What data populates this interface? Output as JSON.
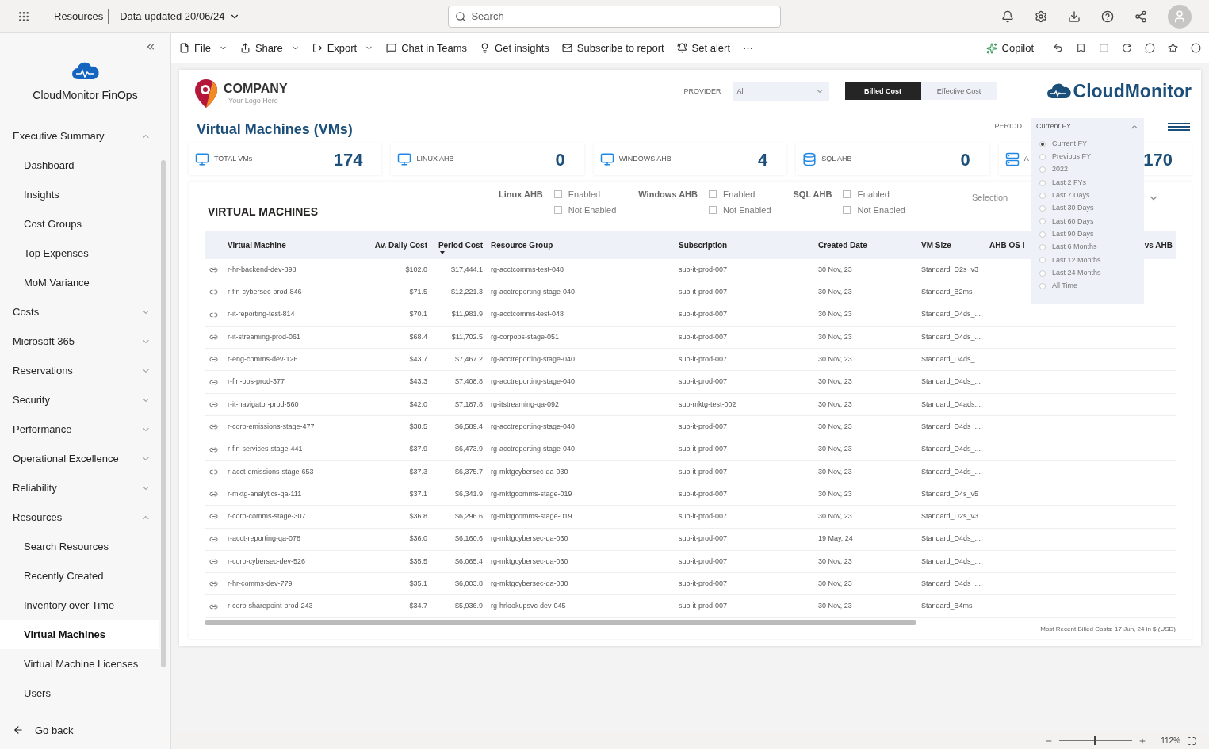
{
  "topbar": {
    "breadcrumb": "Resources",
    "data_updated": "Data updated 20/06/24",
    "search": {
      "placeholder": "Search"
    }
  },
  "sidebar": {
    "title": "CloudMonitor FinOps",
    "items": [
      {
        "label": "Executive Summary",
        "expanded": true,
        "children": [
          {
            "label": "Dashboard",
            "selected": false
          },
          {
            "label": "Insights",
            "selected": false
          },
          {
            "label": "Cost Groups",
            "selected": false
          },
          {
            "label": "Top Expenses",
            "selected": false
          },
          {
            "label": "MoM Variance",
            "selected": false
          }
        ]
      },
      {
        "label": "Costs",
        "expanded": false
      },
      {
        "label": "Microsoft 365",
        "expanded": false
      },
      {
        "label": "Reservations",
        "expanded": false
      },
      {
        "label": "Security",
        "expanded": false
      },
      {
        "label": "Performance",
        "expanded": false
      },
      {
        "label": "Operational Excellence",
        "expanded": false
      },
      {
        "label": "Reliability",
        "expanded": false
      },
      {
        "label": "Resources",
        "expanded": true,
        "children": [
          {
            "label": "Search Resources",
            "selected": false
          },
          {
            "label": "Recently Created",
            "selected": false
          },
          {
            "label": "Inventory over Time",
            "selected": false
          },
          {
            "label": "Virtual Machines",
            "selected": true
          },
          {
            "label": "Virtual Machine Licenses",
            "selected": false
          },
          {
            "label": "Users",
            "selected": false
          }
        ]
      }
    ],
    "go_back": "Go back"
  },
  "toolbar": {
    "left": [
      {
        "label": "File",
        "kind": "file",
        "caret": true
      },
      {
        "label": "Share",
        "kind": "share",
        "caret": true
      },
      {
        "label": "Export",
        "kind": "export",
        "caret": true
      },
      {
        "label": "Chat in Teams",
        "kind": "teams",
        "caret": false
      },
      {
        "label": "Get insights",
        "kind": "insights",
        "caret": false
      },
      {
        "label": "Subscribe to report",
        "kind": "subscribe",
        "caret": false
      },
      {
        "label": "Set alert",
        "kind": "alert",
        "caret": false
      }
    ],
    "more": "⋯",
    "copilot": "Copilot"
  },
  "report": {
    "logo": {
      "name": "COMPANY",
      "tagline": "Your Logo Here"
    },
    "title": "Virtual Machines (VMs)",
    "brand": "CloudMonitor",
    "provider": {
      "label": "PROVIDER",
      "value": "All"
    },
    "cost_toggle": [
      {
        "label": "Billed Cost",
        "selected": true
      },
      {
        "label": "Effective Cost",
        "selected": false
      }
    ],
    "period": {
      "label": "PERIOD",
      "value": "Current FY",
      "options": [
        {
          "label": "Current FY",
          "selected": true
        },
        {
          "label": "Previous FY",
          "selected": false
        },
        {
          "label": "2022",
          "selected": false
        },
        {
          "label": "Last 2 FYs",
          "selected": false
        },
        {
          "label": "Last 7 Days",
          "selected": false
        },
        {
          "label": "Last 30 Days",
          "selected": false
        },
        {
          "label": "Last 60 Days",
          "selected": false
        },
        {
          "label": "Last 90 Days",
          "selected": false
        },
        {
          "label": "Last 6 Months",
          "selected": false
        },
        {
          "label": "Last 12 Months",
          "selected": false
        },
        {
          "label": "Last 24 Months",
          "selected": false
        },
        {
          "label": "All Time",
          "selected": false
        }
      ]
    },
    "kpis": [
      {
        "label": "TOTAL VMs",
        "value": "174",
        "kind": "vm"
      },
      {
        "label": "LINUX AHB",
        "value": "0",
        "kind": "vm"
      },
      {
        "label": "WINDOWS AHB",
        "value": "4",
        "kind": "vm"
      },
      {
        "label": "SQL AHB",
        "value": "0",
        "kind": "sql"
      },
      {
        "label": "A",
        "value": "170",
        "kind": "server"
      }
    ],
    "section_title": "VIRTUAL MACHINES",
    "filters": [
      {
        "label": "Linux AHB",
        "options": [
          {
            "label": "Enabled",
            "checked": false
          },
          {
            "label": "Not Enabled",
            "checked": false
          }
        ]
      },
      {
        "label": "Windows AHB",
        "options": [
          {
            "label": "Enabled",
            "checked": false
          },
          {
            "label": "Not Enabled",
            "checked": false
          }
        ]
      },
      {
        "label": "SQL AHB",
        "options": [
          {
            "label": "Enabled",
            "checked": false
          },
          {
            "label": "Not Enabled",
            "checked": false
          }
        ]
      }
    ],
    "selection": {
      "placeholder": "Selection"
    },
    "table": {
      "columns": [
        {
          "label": "Virtual Machine",
          "sorted": false
        },
        {
          "label": "Av. Daily Cost",
          "sorted": false
        },
        {
          "label": "Period Cost",
          "sorted": true
        },
        {
          "label": "Resource Group",
          "sorted": false
        },
        {
          "label": "Subscription",
          "sorted": false
        },
        {
          "label": "Created Date",
          "sorted": false
        },
        {
          "label": "VM Size",
          "sorted": false
        },
        {
          "label": "AHB OS I",
          "sorted": false
        },
        {
          "label": "vs AHB",
          "sorted": false
        }
      ],
      "rows": [
        [
          "r-hr-backend-dev-898",
          "$102.0",
          "$17,444.1",
          "rg-acctcomms-test-048",
          "sub-it-prod-007",
          "30 Nov, 23",
          "Standard_D2s_v3"
        ],
        [
          "r-fin-cybersec-prod-846",
          "$71.5",
          "$12,221.3",
          "rg-acctreporting-stage-040",
          "sub-it-prod-007",
          "30 Nov, 23",
          "Standard_B2ms"
        ],
        [
          "r-it-reporting-test-814",
          "$70.1",
          "$11,981.9",
          "rg-acctcomms-test-048",
          "sub-it-prod-007",
          "30 Nov, 23",
          "Standard_D4ds_..."
        ],
        [
          "r-it-streaming-prod-061",
          "$68.4",
          "$11,702.5",
          "rg-corpops-stage-051",
          "sub-it-prod-007",
          "30 Nov, 23",
          "Standard_D4ds_..."
        ],
        [
          "r-eng-comms-dev-126",
          "$43.7",
          "$7,467.2",
          "rg-acctreporting-stage-040",
          "sub-it-prod-007",
          "30 Nov, 23",
          "Standard_D4ds_..."
        ],
        [
          "r-fin-ops-prod-377",
          "$43.3",
          "$7,408.8",
          "rg-acctreporting-stage-040",
          "sub-it-prod-007",
          "30 Nov, 23",
          "Standard_D4ds_..."
        ],
        [
          "r-it-navigator-prod-560",
          "$42.0",
          "$7,187.8",
          "rg-itstreaming-qa-092",
          "sub-mktg-test-002",
          "30 Nov, 23",
          "Standard_D4ads..."
        ],
        [
          "r-corp-emissions-stage-477",
          "$38.5",
          "$6,589.4",
          "rg-acctreporting-stage-040",
          "sub-it-prod-007",
          "30 Nov, 23",
          "Standard_D4ds_..."
        ],
        [
          "r-fin-services-stage-441",
          "$37.9",
          "$6,473.9",
          "rg-acctreporting-stage-040",
          "sub-it-prod-007",
          "30 Nov, 23",
          "Standard_D4ds_..."
        ],
        [
          "r-acct-emissions-stage-653",
          "$37.3",
          "$6,375.7",
          "rg-mktgcybersec-qa-030",
          "sub-it-prod-007",
          "30 Nov, 23",
          "Standard_D4ds_..."
        ],
        [
          "r-mktg-analytics-qa-111",
          "$37.1",
          "$6,341.9",
          "rg-mktgcomms-stage-019",
          "sub-it-prod-007",
          "30 Nov, 23",
          "Standard_D4s_v5"
        ],
        [
          "r-corp-comms-stage-307",
          "$36.8",
          "$6,296.6",
          "rg-mktgcomms-stage-019",
          "sub-it-prod-007",
          "30 Nov, 23",
          "Standard_D2s_v3"
        ],
        [
          "r-acct-reporting-qa-078",
          "$36.0",
          "$6,160.6",
          "rg-mktgcybersec-qa-030",
          "sub-it-prod-007",
          "19 May, 24",
          "Standard_D4ds_..."
        ],
        [
          "r-corp-cybersec-dev-526",
          "$35.5",
          "$6,065.4",
          "rg-mktgcybersec-qa-030",
          "sub-it-prod-007",
          "30 Nov, 23",
          "Standard_D4ds_..."
        ],
        [
          "r-hr-comms-dev-779",
          "$35.1",
          "$6,003.8",
          "rg-mktgcybersec-qa-030",
          "sub-it-prod-007",
          "30 Nov, 23",
          "Standard_D4ds_..."
        ],
        [
          "r-corp-sharepoint-prod-243",
          "$34.7",
          "$5,936.9",
          "rg-hrlookupsvc-dev-045",
          "sub-it-prod-007",
          "30 Nov, 23",
          "Standard_B4ms"
        ]
      ]
    },
    "footnote": "Most Recent Billed Costs: 17 Jun, 24 in $ (USD)"
  },
  "status_bar": {
    "zoom": {
      "level": 0.5,
      "reading": "112%"
    }
  }
}
